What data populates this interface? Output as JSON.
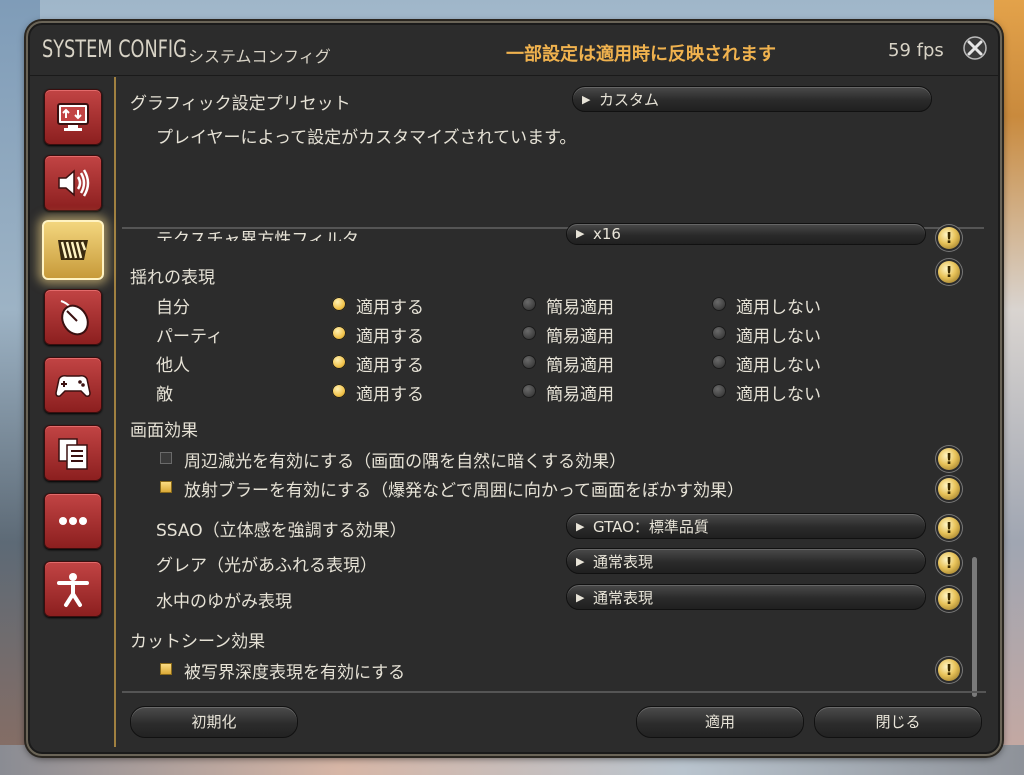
{
  "window": {
    "title_en": "SYSTEM CONFIG",
    "title_jp": "システムコンフィグ",
    "notice": "一部設定は適用時に反映されます",
    "fps": "59 fps"
  },
  "sidebar": {
    "items": [
      {
        "name": "display-settings",
        "icon": "monitor-icon"
      },
      {
        "name": "sound-settings",
        "icon": "speaker-icon"
      },
      {
        "name": "graphics-settings",
        "icon": "graphics-icon",
        "active": true
      },
      {
        "name": "mouse-settings",
        "icon": "mouse-icon"
      },
      {
        "name": "gamepad-settings",
        "icon": "gamepad-icon"
      },
      {
        "name": "other-settings",
        "icon": "document-icon"
      },
      {
        "name": "more-settings",
        "icon": "ellipsis-icon"
      },
      {
        "name": "accessibility-settings",
        "icon": "person-icon"
      }
    ]
  },
  "preset": {
    "label": "グラフィック設定プリセット",
    "value": "カスタム",
    "description": "プレイヤーによって設定がカスタマイズされています。"
  },
  "settings": {
    "texture_filter": {
      "label": "テクスチャ異方性フィルタ",
      "value": "x16"
    },
    "sway": {
      "label": "揺れの表現",
      "options": [
        "適用する",
        "簡易適用",
        "適用しない"
      ],
      "rows": [
        {
          "label": "自分",
          "selected": 0
        },
        {
          "label": "パーティ",
          "selected": 0
        },
        {
          "label": "他人",
          "selected": 0
        },
        {
          "label": "敵",
          "selected": 0
        }
      ]
    },
    "screen_effects": {
      "label": "画面効果",
      "checks": [
        {
          "label": "周辺減光を有効にする（画面の隅を自然に暗くする効果）",
          "checked": false
        },
        {
          "label": "放射ブラーを有効にする（爆発などで周囲に向かって画面をぼかす効果）",
          "checked": true
        }
      ],
      "dropdowns": [
        {
          "label": "SSAO（立体感を強調する効果）",
          "value": "GTAO：標準品質"
        },
        {
          "label": "グレア（光があふれる表現）",
          "value": "通常表現"
        },
        {
          "label": "水中のゆがみ表現",
          "value": "通常表現"
        }
      ]
    },
    "cutscene": {
      "label": "カットシーン効果",
      "checks": [
        {
          "label": "被写界深度表現を有効にする",
          "checked": true
        }
      ]
    }
  },
  "footer": {
    "reset": "初期化",
    "apply": "適用",
    "close": "閉じる"
  },
  "colors": {
    "notice": "#f0b24e",
    "active_tab": "#f3d67e",
    "tab": "#c24444",
    "window_bg": "#2c2c2c"
  }
}
